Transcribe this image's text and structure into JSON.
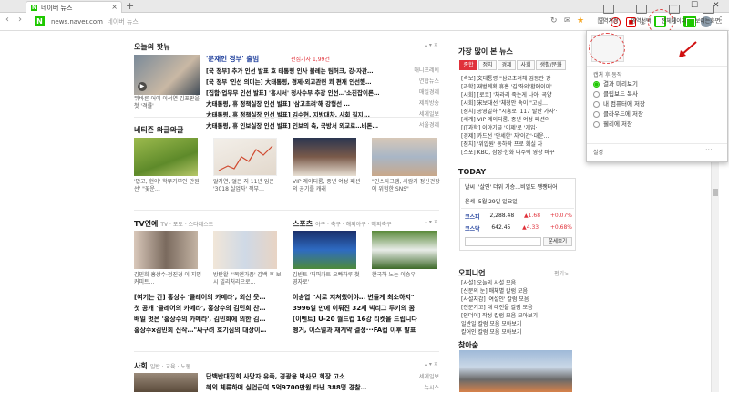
{
  "browser": {
    "tab_title": "네이버 뉴스",
    "url_domain": "news.naver.com",
    "url_title": "네이버 뉴스",
    "logo_letter": "N"
  },
  "headline": {
    "section": "오늘의 핫뉴",
    "lead_title": "'문재인 경부' 출범",
    "lead_badge": "편집기사 1,99건",
    "photo_caption": "뷔바른 어이 이석연 김포판을 첫 '격률'",
    "items": [
      {
        "text": "[국 정부] 추가 인선 발표 호 태통령 인사 블레는 팀허크, 강·자관…",
        "src": "매니프레이"
      },
      {
        "text": "[국 정부 '인선 의미는] 大태통령, 경제·외교관련 쾨 편재 인선했…",
        "src": "연합뉴스"
      },
      {
        "text": "[집함·업무무 인선 발표] '홍시서' 청사수부 추강 인선…'소진잡이론…",
        "src": "매일경제"
      },
      {
        "text": "大태통령, 휴 정책실장 인선 발표] '삼고초려'해 강형선 …",
        "src": "제외방송"
      },
      {
        "text": "大태통령, 휴 정책실장 인선 발표] 김수현, 지방대차, 사회 질지...",
        "src": "세계일보"
      },
      {
        "text": "大태통령, 휴 인보실장 인선 발표] 인보의 축, 국방서 외교로…비톤…",
        "src": "서울경제"
      }
    ]
  },
  "netizen": {
    "section": "네티즌 와글와글",
    "items": [
      {
        "caption": "'밥고, 현어' 학무기부인 만원선' \"꽃운…"
      },
      {
        "caption": "알자연, 얼은 지 11년 입은 '3018 실업자' 적부…"
      },
      {
        "caption": "VIP 레이디룸, 중년 여성 패션의 공기를 캐래"
      },
      {
        "caption": "\"인스타그램, 사람가 정신건강에 위험한 SNS\""
      }
    ]
  },
  "tv": {
    "section": "TV연예",
    "subs": "TV · 포토 · 스타제스트",
    "caps": [
      "김민희 홍상수·정진경 이 지명 커피트…",
      "방탄왈 \"'목엔가품' 갑백 후 보시 빌리처리으로…",
      "김빈트 '퍼퍼카트 오빠하루 첫영자로'",
      "한국하 노는 이승우"
    ],
    "links": [
      "[여기는 칸] 홍상수 '클레어의 카메라', 외신 웃…",
      "첫 공개 '클레어의 카메라', 홍상수의 김민희 찬…",
      "배일 벗은 '홍상수의 카메라', 김민희에 의한 김…",
      "홍상수x김민희 신작…\"싸구려 호기심의 대상이…"
    ]
  },
  "sports": {
    "section": "스포츠",
    "subs": "야구 · 축구 · 해외야구 · 해외축구",
    "links": [
      "이승엽 \"서로 지쳐했어야… 변들게 최소하지\"",
      "3996일 만에 이뤄진 32세 빅리그 루키의 꿈",
      "[이벤트] U-20 월드컵 16강 티켓을 드립니다",
      "벵거, 이스널과 재계약 결정···FA컵 이후 발표"
    ]
  },
  "society": {
    "section": "사회",
    "subs": "일반 · 교육 · 노동",
    "links": [
      {
        "text": "단백반대집회 사망자 유족, 경광용 박사모 회장 고소",
        "src": "세계일보"
      },
      {
        "text": "혜외 체류하며 실업급여 5억9700만원 타낸 388명 경찰…",
        "src": "뉴시스"
      }
    ]
  },
  "most_read": {
    "title": "가장 많이 본 뉴스",
    "tabs": [
      "종합",
      "정치",
      "경제",
      "사회",
      "생활/문화"
    ],
    "items": [
      "[속보] 文태통령 \"삼고초려해 김동란 강·",
      "[과학] 재범계획 휴흡 '김'좌의'환에이이'",
      "[시회] [로코] '차라리 죽는게 나아' 곡양",
      "[시회] 宋보대선 '체청안 속이 \"고심…",
      "[점치] 공영일하 \"시흥로 '117 탈한 가자'·",
      "[세계] VIP 레이디룸, 중년 여성 패션의",
      "[IT과학] 이야기글 '이제'로 '개입·",
      "[경제] 카드선 '안세한' 자'이간'·대운…",
      "[점치] '위압원' 동하락 프로 회실 차",
      "[스포] KBO, 삼성·한화 내주릭 영상 바꾸"
    ]
  },
  "today": {
    "title": "TODAY",
    "weather_label": "날씨",
    "weather_text": "'살인' 더위 기승…비일도 쨍쨍터어",
    "date_label": "운세",
    "date_text": "5월 29일 일요일",
    "stocks": [
      {
        "name": "코스피",
        "value": "2,288.48",
        "change": "▲1.68",
        "pct": "+0.07%"
      },
      {
        "name": "코스닥",
        "value": "642.45",
        "change": "▲4.33",
        "pct": "+0.68%"
      }
    ],
    "search_btn": "운세보기"
  },
  "opinion": {
    "title": "오피니언",
    "more": "편기>",
    "items": [
      "[사설] 오늘의 사설 모음",
      "[신문의 눈] 매체별 칼럼 모음",
      "[사설지감] '여설인' 칼럼 모음",
      "[전문기고] 대 대전을 칼럼 모음",
      "[인더이] 작성 칼럼 모음 모아보기",
      "일반일 칼럼 모음 모아보기",
      "칼어인 칼럼 모음 모아보기"
    ]
  },
  "photo": {
    "title": "찾아숨"
  },
  "capture_popup": {
    "options": [
      "영역지정",
      "영역선택",
      "전체페이지",
      "보이는화면"
    ],
    "after_title": "캡처 후 동작",
    "after_options": [
      "결과 미리보기",
      "클립보드 복사",
      "내 컴퓨터에 저장",
      "클라우드에 저장",
      "웰리에 저장"
    ],
    "selected_index": 0,
    "settings_label": "설정",
    "more_label": "···"
  },
  "colors": {
    "naver_green": "#1ec800",
    "accent_red": "#e0313a"
  }
}
